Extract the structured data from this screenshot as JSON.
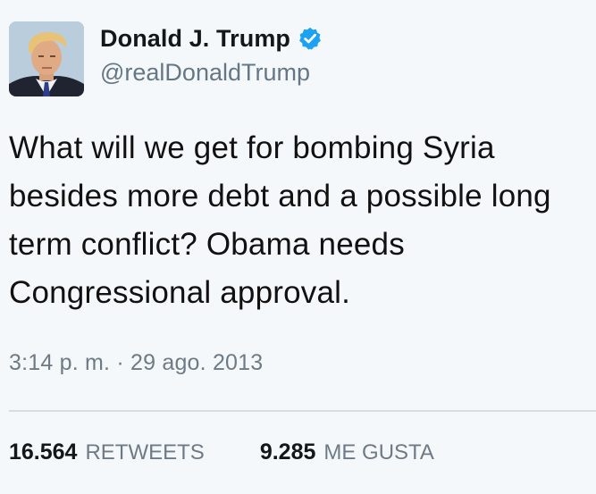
{
  "author": {
    "display_name": "Donald J. Trump",
    "handle": "@realDonaldTrump",
    "verified": true,
    "verified_badge_icon": "verified-check-icon",
    "avatar_icon": "user-avatar"
  },
  "tweet": {
    "text": "What will we get for bombing Syria besides more debt and a possible long term conflict? Obama needs Congressional approval.",
    "timestamp": "3:14 p. m. · 29 ago. 2013"
  },
  "stats": {
    "retweets_count": "16.564",
    "retweets_label": "RETWEETS",
    "likes_count": "9.285",
    "likes_label": "ME GUSTA"
  },
  "colors": {
    "background": "#f5f8fa",
    "text": "#111111",
    "muted": "#6e7b87",
    "verified_blue": "#1da1f2",
    "divider": "#d6dde3"
  }
}
